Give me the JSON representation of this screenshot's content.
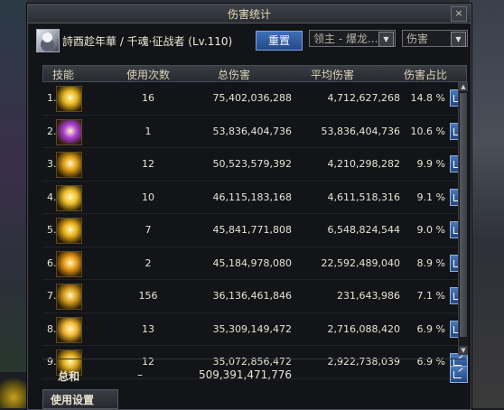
{
  "window": {
    "title": "伤害统计",
    "close_label": "×"
  },
  "header": {
    "character": "詩酉趁年華 / 千魂·征战者 (Lv.110)",
    "reset_label": "重置",
    "target_select": "领主 - 爆龙...",
    "metric_select": "伤害"
  },
  "columns": {
    "skill": "技能",
    "uses": "使用次数",
    "total": "总伤害",
    "avg": "平均伤害",
    "pct": "伤害占比"
  },
  "rows": [
    {
      "idx": "1.",
      "uses": "16",
      "total": "75,402,036,288",
      "avg": "4,712,627,268",
      "pct": "14.8 %",
      "icon": "golden-slash-skill-icon",
      "color": "#e8b820"
    },
    {
      "idx": "2.",
      "uses": "1",
      "total": "53,836,404,736",
      "avg": "53,836,404,736",
      "pct": "10.6 %",
      "icon": "purple-burst-skill-icon",
      "color": "#b040d8"
    },
    {
      "idx": "3.",
      "uses": "12",
      "total": "50,523,579,392",
      "avg": "4,210,298,282",
      "pct": "9.9 %",
      "icon": "golden-strike-skill-icon",
      "color": "#e0a018"
    },
    {
      "idx": "4.",
      "uses": "10",
      "total": "46,115,183,168",
      "avg": "4,611,518,316",
      "pct": "9.1 %",
      "icon": "golden-spikes-skill-icon",
      "color": "#f0c028"
    },
    {
      "idx": "5.",
      "uses": "7",
      "total": "45,841,771,808",
      "avg": "6,548,824,544",
      "pct": "9.0 %",
      "icon": "golden-thrust-skill-icon",
      "color": "#e8b018"
    },
    {
      "idx": "6.",
      "uses": "2",
      "total": "45,184,978,080",
      "avg": "22,592,489,040",
      "pct": "8.9 %",
      "icon": "golden-spin-skill-icon",
      "color": "#e89a18"
    },
    {
      "idx": "7.",
      "uses": "156",
      "total": "36,136,461,846",
      "avg": "231,643,986",
      "pct": "7.1 %",
      "icon": "golden-dash-skill-icon",
      "color": "#d8a020"
    },
    {
      "idx": "8.",
      "uses": "13",
      "total": "35,309,149,472",
      "avg": "2,716,088,420",
      "pct": "6.9 %",
      "icon": "golden-wave-skill-icon",
      "color": "#f0b830"
    },
    {
      "idx": "9.",
      "uses": "12",
      "total": "35,072,856,472",
      "avg": "2,922,738,039",
      "pct": "6.9 %",
      "icon": "golden-pillar-skill-icon",
      "color": "#e0b020"
    }
  ],
  "total": {
    "label": "总和",
    "uses": "–",
    "total": "509,391,471,776"
  },
  "settings_label": "使用设置"
}
